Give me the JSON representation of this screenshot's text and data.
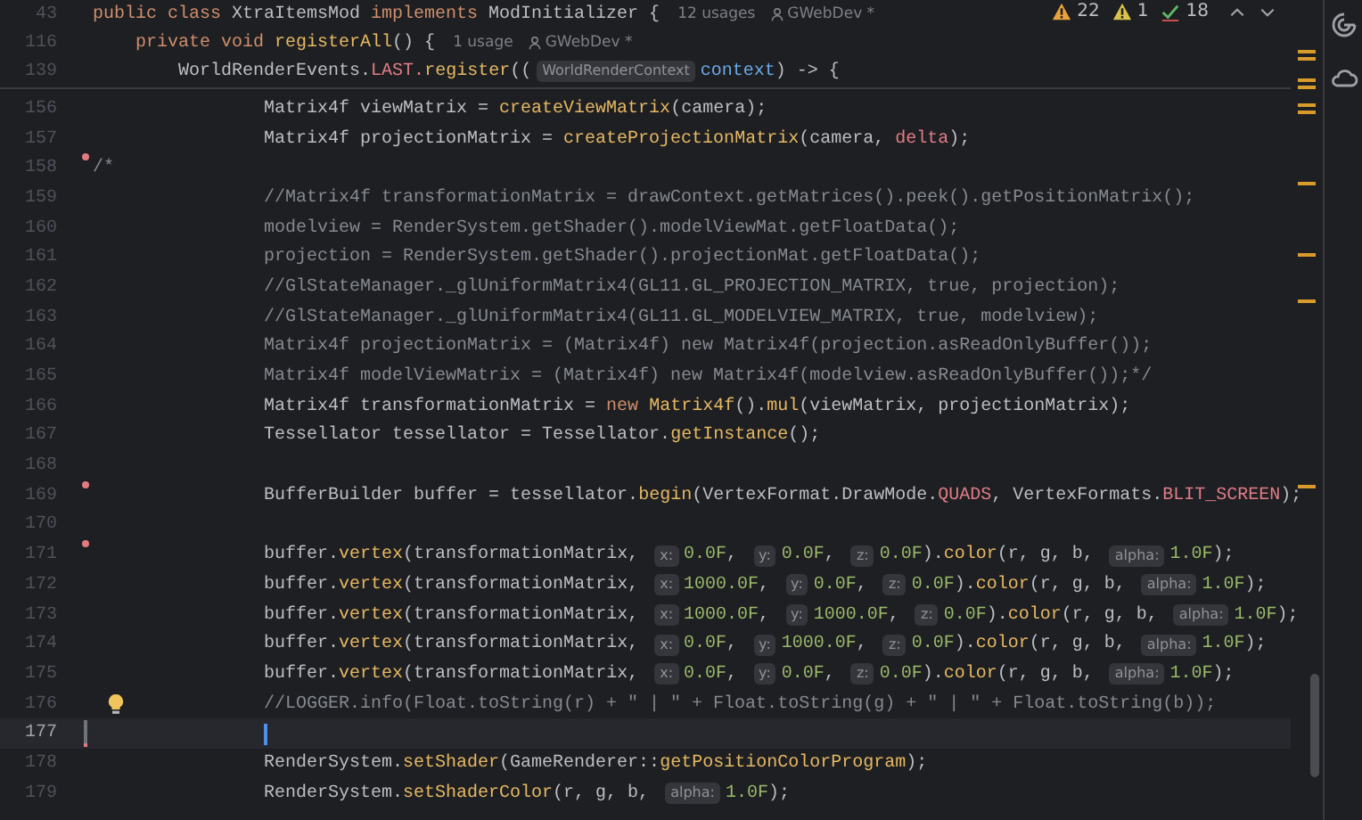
{
  "sticky_lines": [
    {
      "number": "43",
      "tokens": [
        {
          "kind": "k",
          "text": "public class "
        },
        {
          "kind": "p",
          "text": "XtraItemsMod "
        },
        {
          "kind": "k",
          "text": "implements "
        },
        {
          "kind": "p",
          "text": "ModInitializer {"
        },
        {
          "kind": "u",
          "text": "12 usages"
        },
        {
          "kind": "a",
          "text": "GWebDev *"
        }
      ]
    },
    {
      "number": "116",
      "tokens": [
        {
          "kind": "k",
          "text": "    private void "
        },
        {
          "kind": "f",
          "text": "registerAll"
        },
        {
          "kind": "p",
          "text": "() {"
        },
        {
          "kind": "u",
          "text": "1 usage"
        },
        {
          "kind": "a",
          "text": "GWebDev *"
        }
      ]
    },
    {
      "number": "139",
      "tokens": [
        {
          "kind": "p",
          "text": "        WorldRenderEvents."
        },
        {
          "kind": "v",
          "text": "LAST."
        },
        {
          "kind": "f",
          "text": "register"
        },
        {
          "kind": "p",
          "text": "(("
        },
        {
          "kind": "h",
          "text": "WorldRenderContext"
        },
        {
          "kind": "b",
          "text": "context"
        },
        {
          "kind": "p",
          "text": ") -> {"
        }
      ]
    }
  ],
  "inspections": {
    "warnings": "22",
    "weak_warnings": "1",
    "passed": "18"
  },
  "lines": [
    {
      "number": "156",
      "current": false,
      "tokens": [
        {
          "kind": "p",
          "text": "                Matrix4f viewMatrix = "
        },
        {
          "kind": "f",
          "text": "createViewMatrix"
        },
        {
          "kind": "p",
          "text": "(camera);"
        }
      ]
    },
    {
      "number": "157",
      "current": false,
      "tokens": [
        {
          "kind": "p",
          "text": "                Matrix4f projectionMatrix = "
        },
        {
          "kind": "f",
          "text": "createProjectionMatrix"
        },
        {
          "kind": "p",
          "text": "(camera, "
        },
        {
          "kind": "v",
          "text": "delta"
        },
        {
          "kind": "p",
          "text": ");"
        }
      ]
    },
    {
      "number": "158",
      "current": false,
      "deleted_marker": true,
      "tokens": [
        {
          "kind": "c",
          "text": "/*"
        }
      ]
    },
    {
      "number": "159",
      "current": false,
      "tokens": [
        {
          "kind": "c",
          "text": "                //Matrix4f transformationMatrix = drawContext.getMatrices().peek().getPositionMatrix();"
        }
      ]
    },
    {
      "number": "160",
      "current": false,
      "tokens": [
        {
          "kind": "c",
          "text": "                modelview = RenderSystem.getShader().modelViewMat.getFloatData();"
        }
      ]
    },
    {
      "number": "161",
      "current": false,
      "tokens": [
        {
          "kind": "c",
          "text": "                projection = RenderSystem.getShader().projectionMat.getFloatData();"
        }
      ]
    },
    {
      "number": "162",
      "current": false,
      "tokens": [
        {
          "kind": "c",
          "text": "                //GlStateManager._glUniformMatrix4(GL11.GL_PROJECTION_MATRIX, true, projection);"
        }
      ]
    },
    {
      "number": "163",
      "current": false,
      "tokens": [
        {
          "kind": "c",
          "text": "                //GlStateManager._glUniformMatrix4(GL11.GL_MODELVIEW_MATRIX, true, modelview);"
        }
      ]
    },
    {
      "number": "164",
      "current": false,
      "tokens": [
        {
          "kind": "c",
          "text": "                Matrix4f projectionMatrix = (Matrix4f) new Matrix4f(projection.asReadOnlyBuffer());"
        }
      ]
    },
    {
      "number": "165",
      "current": false,
      "tokens": [
        {
          "kind": "c",
          "text": "                Matrix4f modelViewMatrix = (Matrix4f) new Matrix4f(modelview.asReadOnlyBuffer());*/"
        }
      ]
    },
    {
      "number": "166",
      "current": false,
      "tokens": [
        {
          "kind": "p",
          "text": "                Matrix4f transformationMatrix = "
        },
        {
          "kind": "k",
          "text": "new "
        },
        {
          "kind": "f",
          "text": "Matrix4f"
        },
        {
          "kind": "p",
          "text": "()."
        },
        {
          "kind": "f",
          "text": "mul"
        },
        {
          "kind": "p",
          "text": "(viewMatrix, projectionMatrix);"
        }
      ]
    },
    {
      "number": "167",
      "current": false,
      "tokens": [
        {
          "kind": "p",
          "text": "                Tessellator tessellator = Tessellator."
        },
        {
          "kind": "f",
          "text": "getInstance"
        },
        {
          "kind": "p",
          "text": "();"
        }
      ]
    },
    {
      "number": "168",
      "current": false
    },
    {
      "number": "169",
      "current": false,
      "deleted_marker": true,
      "tokens": [
        {
          "kind": "p",
          "text": "                BufferBuilder buffer = tessellator."
        },
        {
          "kind": "f",
          "text": "begin"
        },
        {
          "kind": "p",
          "text": "(VertexFormat.DrawMode."
        },
        {
          "kind": "v",
          "text": "QUADS"
        },
        {
          "kind": "p",
          "text": ", VertexFormats."
        },
        {
          "kind": "v",
          "text": "BLIT_SCREEN"
        },
        {
          "kind": "p",
          "text": ");"
        }
      ]
    },
    {
      "number": "170",
      "current": false
    },
    {
      "number": "171",
      "current": false,
      "deleted_marker": true,
      "tokens": [
        {
          "kind": "p",
          "text": "                buffer."
        },
        {
          "kind": "f",
          "text": "vertex"
        },
        {
          "kind": "p",
          "text": "(transformationMatrix, "
        },
        {
          "kind": "h",
          "text": "x:"
        },
        {
          "kind": "n",
          "text": "0.0F"
        },
        {
          "kind": "p",
          "text": ", "
        },
        {
          "kind": "h",
          "text": "y:"
        },
        {
          "kind": "n",
          "text": "0.0F"
        },
        {
          "kind": "p",
          "text": ", "
        },
        {
          "kind": "h",
          "text": "z:"
        },
        {
          "kind": "n",
          "text": "0.0F"
        },
        {
          "kind": "p",
          "text": ")."
        },
        {
          "kind": "f",
          "text": "color"
        },
        {
          "kind": "p",
          "text": "(r, g, b, "
        },
        {
          "kind": "h",
          "text": "alpha:"
        },
        {
          "kind": "n",
          "text": "1.0F"
        },
        {
          "kind": "p",
          "text": ");"
        }
      ]
    },
    {
      "number": "172",
      "current": false,
      "tokens": [
        {
          "kind": "p",
          "text": "                buffer."
        },
        {
          "kind": "f",
          "text": "vertex"
        },
        {
          "kind": "p",
          "text": "(transformationMatrix, "
        },
        {
          "kind": "h",
          "text": "x:"
        },
        {
          "kind": "n",
          "text": "1000.0F"
        },
        {
          "kind": "p",
          "text": ", "
        },
        {
          "kind": "h",
          "text": "y:"
        },
        {
          "kind": "n",
          "text": "0.0F"
        },
        {
          "kind": "p",
          "text": ", "
        },
        {
          "kind": "h",
          "text": "z:"
        },
        {
          "kind": "n",
          "text": "0.0F"
        },
        {
          "kind": "p",
          "text": ")."
        },
        {
          "kind": "f",
          "text": "color"
        },
        {
          "kind": "p",
          "text": "(r, g, b, "
        },
        {
          "kind": "h",
          "text": "alpha:"
        },
        {
          "kind": "n",
          "text": "1.0F"
        },
        {
          "kind": "p",
          "text": ");"
        }
      ]
    },
    {
      "number": "173",
      "current": false,
      "tokens": [
        {
          "kind": "p",
          "text": "                buffer."
        },
        {
          "kind": "f",
          "text": "vertex"
        },
        {
          "kind": "p",
          "text": "(transformationMatrix, "
        },
        {
          "kind": "h",
          "text": "x:"
        },
        {
          "kind": "n",
          "text": "1000.0F"
        },
        {
          "kind": "p",
          "text": ", "
        },
        {
          "kind": "h",
          "text": "y:"
        },
        {
          "kind": "n",
          "text": "1000.0F"
        },
        {
          "kind": "p",
          "text": ", "
        },
        {
          "kind": "h",
          "text": "z:"
        },
        {
          "kind": "n",
          "text": "0.0F"
        },
        {
          "kind": "p",
          "text": ")."
        },
        {
          "kind": "f",
          "text": "color"
        },
        {
          "kind": "p",
          "text": "(r, g, b, "
        },
        {
          "kind": "h",
          "text": "alpha:"
        },
        {
          "kind": "n",
          "text": "1.0F"
        },
        {
          "kind": "p",
          "text": ");"
        }
      ]
    },
    {
      "number": "174",
      "current": false,
      "tokens": [
        {
          "kind": "p",
          "text": "                buffer."
        },
        {
          "kind": "f",
          "text": "vertex"
        },
        {
          "kind": "p",
          "text": "(transformationMatrix, "
        },
        {
          "kind": "h",
          "text": "x:"
        },
        {
          "kind": "n",
          "text": "0.0F"
        },
        {
          "kind": "p",
          "text": ", "
        },
        {
          "kind": "h",
          "text": "y:"
        },
        {
          "kind": "n",
          "text": "1000.0F"
        },
        {
          "kind": "p",
          "text": ", "
        },
        {
          "kind": "h",
          "text": "z:"
        },
        {
          "kind": "n",
          "text": "0.0F"
        },
        {
          "kind": "p",
          "text": ")."
        },
        {
          "kind": "f",
          "text": "color"
        },
        {
          "kind": "p",
          "text": "(r, g, b, "
        },
        {
          "kind": "h",
          "text": "alpha:"
        },
        {
          "kind": "n",
          "text": "1.0F"
        },
        {
          "kind": "p",
          "text": ");"
        }
      ]
    },
    {
      "number": "175",
      "current": false,
      "tokens": [
        {
          "kind": "p",
          "text": "                buffer."
        },
        {
          "kind": "f",
          "text": "vertex"
        },
        {
          "kind": "p",
          "text": "(transformationMatrix, "
        },
        {
          "kind": "h",
          "text": "x:"
        },
        {
          "kind": "n",
          "text": "0.0F"
        },
        {
          "kind": "p",
          "text": ", "
        },
        {
          "kind": "h",
          "text": "y:"
        },
        {
          "kind": "n",
          "text": "0.0F"
        },
        {
          "kind": "p",
          "text": ", "
        },
        {
          "kind": "h",
          "text": "z:"
        },
        {
          "kind": "n",
          "text": "0.0F"
        },
        {
          "kind": "p",
          "text": ")."
        },
        {
          "kind": "f",
          "text": "color"
        },
        {
          "kind": "p",
          "text": "(r, g, b, "
        },
        {
          "kind": "h",
          "text": "alpha:"
        },
        {
          "kind": "n",
          "text": "1.0F"
        },
        {
          "kind": "p",
          "text": ");"
        }
      ]
    },
    {
      "number": "176",
      "current": false,
      "intention_bulb": true,
      "tokens": [
        {
          "kind": "c",
          "text": "                //LOGGER.info(Float.toString(r) + \" | \" + Float.toString(g) + \" | \" + Float.toString(b));"
        }
      ]
    },
    {
      "number": "177",
      "current": true,
      "modified_marker": true
    },
    {
      "number": "178",
      "current": false,
      "tokens": [
        {
          "kind": "p",
          "text": "                RenderSystem."
        },
        {
          "kind": "f",
          "text": "setShader"
        },
        {
          "kind": "p",
          "text": "(GameRenderer::"
        },
        {
          "kind": "f",
          "text": "getPositionColorProgram"
        },
        {
          "kind": "p",
          "text": ");"
        }
      ]
    },
    {
      "number": "179",
      "current": false,
      "tokens": [
        {
          "kind": "p",
          "text": "                RenderSystem."
        },
        {
          "kind": "f",
          "text": "setShaderColor"
        },
        {
          "kind": "p",
          "text": "(r, g, b, "
        },
        {
          "kind": "h",
          "text": "alpha:"
        },
        {
          "kind": "n",
          "text": "1.0F"
        },
        {
          "kind": "p",
          "text": ");"
        }
      ]
    }
  ]
}
